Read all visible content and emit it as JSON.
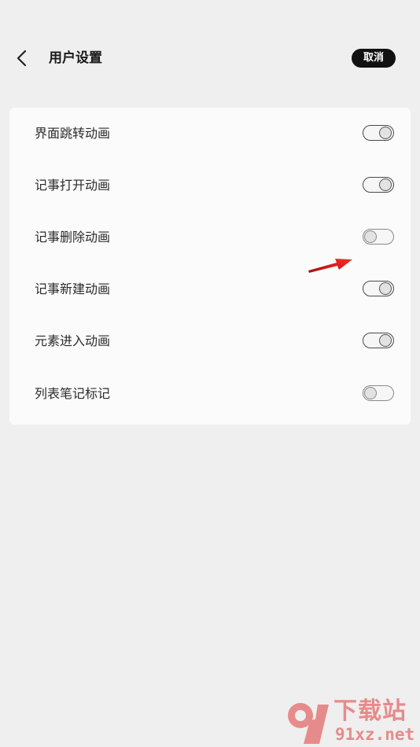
{
  "header": {
    "back_icon": "chevron-left-icon",
    "title": "用户设置",
    "cancel_label": "取消"
  },
  "settings": [
    {
      "label": "界面跳转动画",
      "enabled": true
    },
    {
      "label": "记事打开动画",
      "enabled": true
    },
    {
      "label": "记事删除动画",
      "enabled": false
    },
    {
      "label": "记事新建动画",
      "enabled": true
    },
    {
      "label": "元素进入动画",
      "enabled": true
    },
    {
      "label": "列表笔记标记",
      "enabled": false
    }
  ],
  "annotation": {
    "icon": "red-arrow-icon",
    "color": "#e01818"
  },
  "watermark": {
    "brand": "下载站",
    "url": "91xz.net",
    "color": "#e03a3a"
  }
}
